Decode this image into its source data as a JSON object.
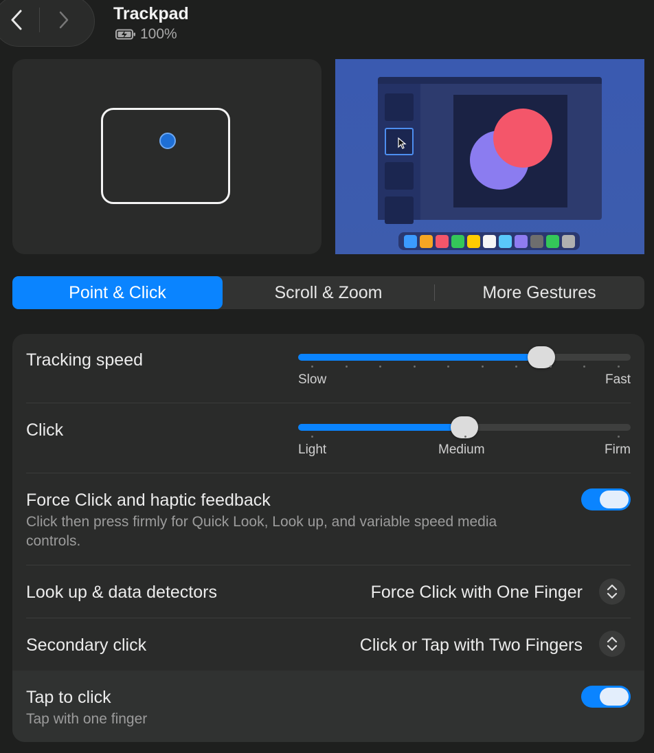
{
  "header": {
    "title": "Trackpad",
    "battery_text": "100%"
  },
  "tabs": [
    {
      "label": "Point & Click",
      "active": true
    },
    {
      "label": "Scroll & Zoom",
      "active": false
    },
    {
      "label": "More Gestures",
      "active": false
    }
  ],
  "settings": {
    "tracking_speed": {
      "label": "Tracking speed",
      "min_label": "Slow",
      "max_label": "Fast",
      "value_fraction": 0.753,
      "ticks": 10
    },
    "click": {
      "label": "Click",
      "min_label": "Light",
      "mid_label": "Medium",
      "max_label": "Firm",
      "value_fraction": 0.5,
      "ticks": 3
    },
    "force_click": {
      "label": "Force Click and haptic feedback",
      "description": "Click then press firmly for Quick Look, Look up, and variable speed media controls.",
      "enabled": true
    },
    "look_up": {
      "label": "Look up & data detectors",
      "value": "Force Click with One Finger"
    },
    "secondary_click": {
      "label": "Secondary click",
      "value": "Click or Tap with Two Fingers"
    },
    "tap_to_click": {
      "label": "Tap to click",
      "description": "Tap with one finger",
      "enabled": true
    }
  },
  "colors": {
    "accent": "#0a84ff",
    "background": "#1e1f1e",
    "card": "#2a2b2a"
  },
  "dock_colors": [
    "#3b9bff",
    "#f5a623",
    "#f2566a",
    "#34c759",
    "#ffcc00",
    "#f5f5f5",
    "#5ac8fa",
    "#8e7cf0",
    "#6e6e6e",
    "#34c759",
    "#b0b0b0"
  ]
}
